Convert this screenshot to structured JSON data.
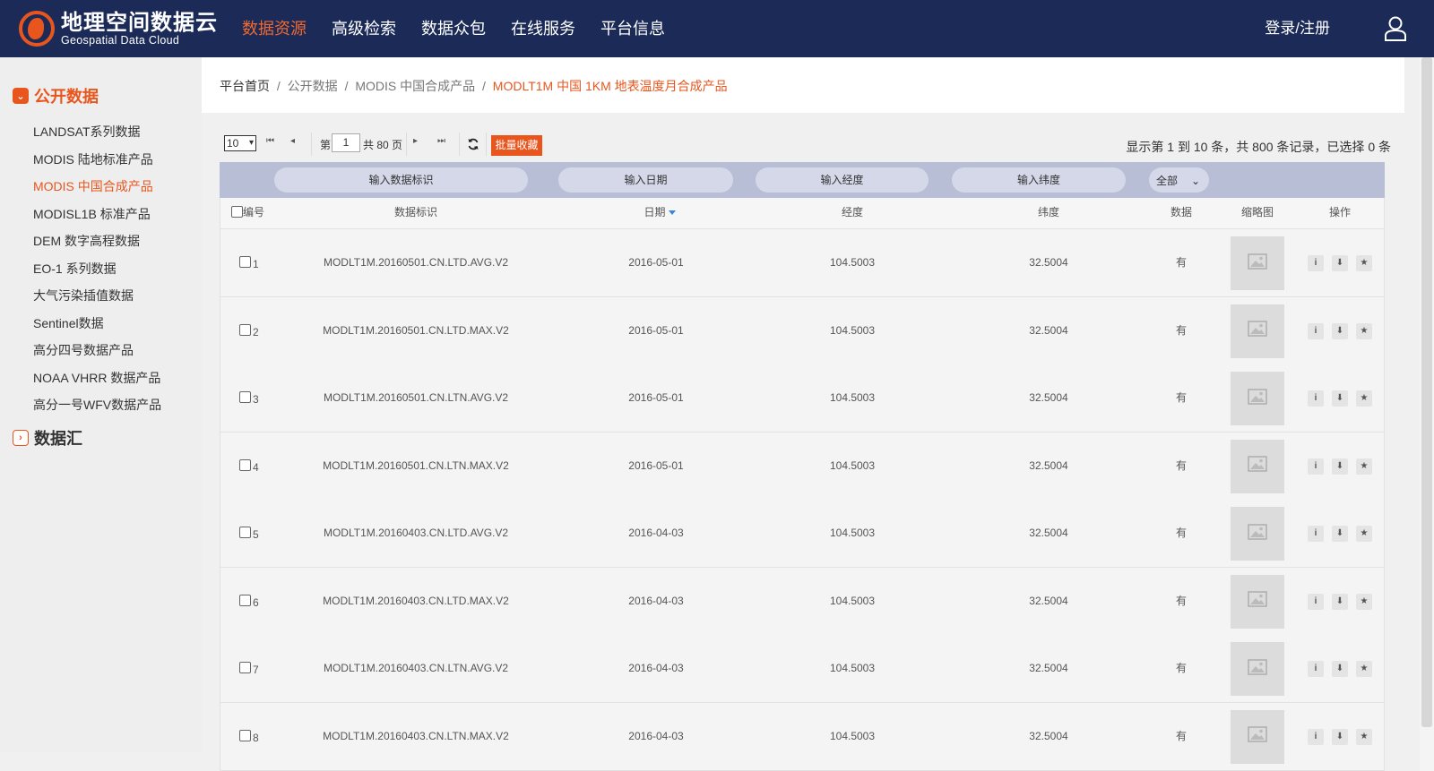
{
  "header": {
    "logo_cn": "地理空间数据云",
    "logo_en": "Geospatial Data Cloud",
    "nav": [
      {
        "label": "数据资源",
        "active": true
      },
      {
        "label": "高级检索",
        "active": false
      },
      {
        "label": "数据众包",
        "active": false
      },
      {
        "label": "在线服务",
        "active": false
      },
      {
        "label": "平台信息",
        "active": false
      }
    ],
    "login_label": "登录/注册",
    "user_icon": "user-icon"
  },
  "sidebar": {
    "categories": [
      {
        "label": "公开数据",
        "expanded": true
      },
      {
        "label": "数据汇",
        "expanded": false
      }
    ],
    "items": [
      {
        "label": "LANDSAT系列数据",
        "active": false
      },
      {
        "label": "MODIS 陆地标准产品",
        "active": false
      },
      {
        "label": "MODIS 中国合成产品",
        "active": true
      },
      {
        "label": "MODISL1B 标准产品",
        "active": false
      },
      {
        "label": "DEM 数字高程数据",
        "active": false
      },
      {
        "label": "EO-1 系列数据",
        "active": false
      },
      {
        "label": "大气污染插值数据",
        "active": false
      },
      {
        "label": "Sentinel数据",
        "active": false
      },
      {
        "label": "高分四号数据产品",
        "active": false
      },
      {
        "label": "NOAA VHRR 数据产品",
        "active": false
      },
      {
        "label": "高分一号WFV数据产品",
        "active": false
      }
    ]
  },
  "breadcrumb": {
    "items": [
      "平台首页",
      "公开数据",
      "MODIS 中国合成产品"
    ],
    "separator": "/",
    "current": "MODLT1M 中国 1KM 地表温度月合成产品"
  },
  "toolbar": {
    "page_size": "10",
    "page_prefix": "第",
    "current_page": "1",
    "page_suffix": "共 80 页",
    "batch_label": "批量收藏",
    "info": "显示第 1 到 10 条，共 800 条记录，已选择 0 条"
  },
  "filters": {
    "id_placeholder": "输入数据标识",
    "date_placeholder": "输入日期",
    "lon_placeholder": "输入经度",
    "lat_placeholder": "输入纬度",
    "data_option": "全部"
  },
  "table": {
    "columns": {
      "num": "编号",
      "id": "数据标识",
      "date": "日期",
      "lon": "经度",
      "lat": "纬度",
      "data": "数据",
      "thumb": "缩略图",
      "ops": "操作"
    },
    "rows": [
      {
        "num": "1",
        "id": "MODLT1M.20160501.CN.LTD.AVG.V2",
        "date": "2016-05-01",
        "lon": "104.5003",
        "lat": "32.5004",
        "data": "有"
      },
      {
        "num": "2",
        "id": "MODLT1M.20160501.CN.LTD.MAX.V2",
        "date": "2016-05-01",
        "lon": "104.5003",
        "lat": "32.5004",
        "data": "有"
      },
      {
        "num": "3",
        "id": "MODLT1M.20160501.CN.LTN.AVG.V2",
        "date": "2016-05-01",
        "lon": "104.5003",
        "lat": "32.5004",
        "data": "有"
      },
      {
        "num": "4",
        "id": "MODLT1M.20160501.CN.LTN.MAX.V2",
        "date": "2016-05-01",
        "lon": "104.5003",
        "lat": "32.5004",
        "data": "有"
      },
      {
        "num": "5",
        "id": "MODLT1M.20160403.CN.LTD.AVG.V2",
        "date": "2016-04-03",
        "lon": "104.5003",
        "lat": "32.5004",
        "data": "有"
      },
      {
        "num": "6",
        "id": "MODLT1M.20160403.CN.LTD.MAX.V2",
        "date": "2016-04-03",
        "lon": "104.5003",
        "lat": "32.5004",
        "data": "有"
      },
      {
        "num": "7",
        "id": "MODLT1M.20160403.CN.LTN.AVG.V2",
        "date": "2016-04-03",
        "lon": "104.5003",
        "lat": "32.5004",
        "data": "有"
      },
      {
        "num": "8",
        "id": "MODLT1M.20160403.CN.LTN.MAX.V2",
        "date": "2016-04-03",
        "lon": "104.5003",
        "lat": "32.5004",
        "data": "有"
      }
    ],
    "ops_icons": [
      "info-icon",
      "download-icon",
      "star-icon"
    ],
    "thumb_icon": "image-placeholder-icon"
  },
  "colors": {
    "header_bg": "#1b2a57",
    "accent": "#e8561e",
    "filter_bar": "#b8bed6",
    "sidebar_bg": "#eeeeee"
  }
}
